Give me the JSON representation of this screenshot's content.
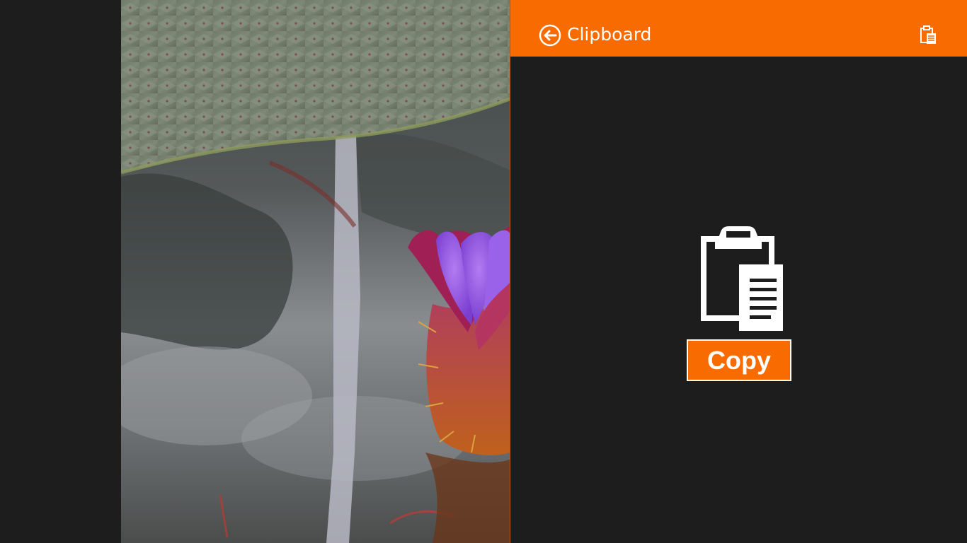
{
  "pane": {
    "title": "Clipboard",
    "back_icon": "back-arrow-circle-icon",
    "header_icon": "clipboard-icon",
    "main_icon": "clipboard-icon",
    "copy_label": "Copy"
  },
  "photo": {
    "subject": "water-lily-pond-photo"
  },
  "colors": {
    "accent": "#f76b00",
    "background": "#1d1d1d",
    "text": "#ffffff"
  }
}
